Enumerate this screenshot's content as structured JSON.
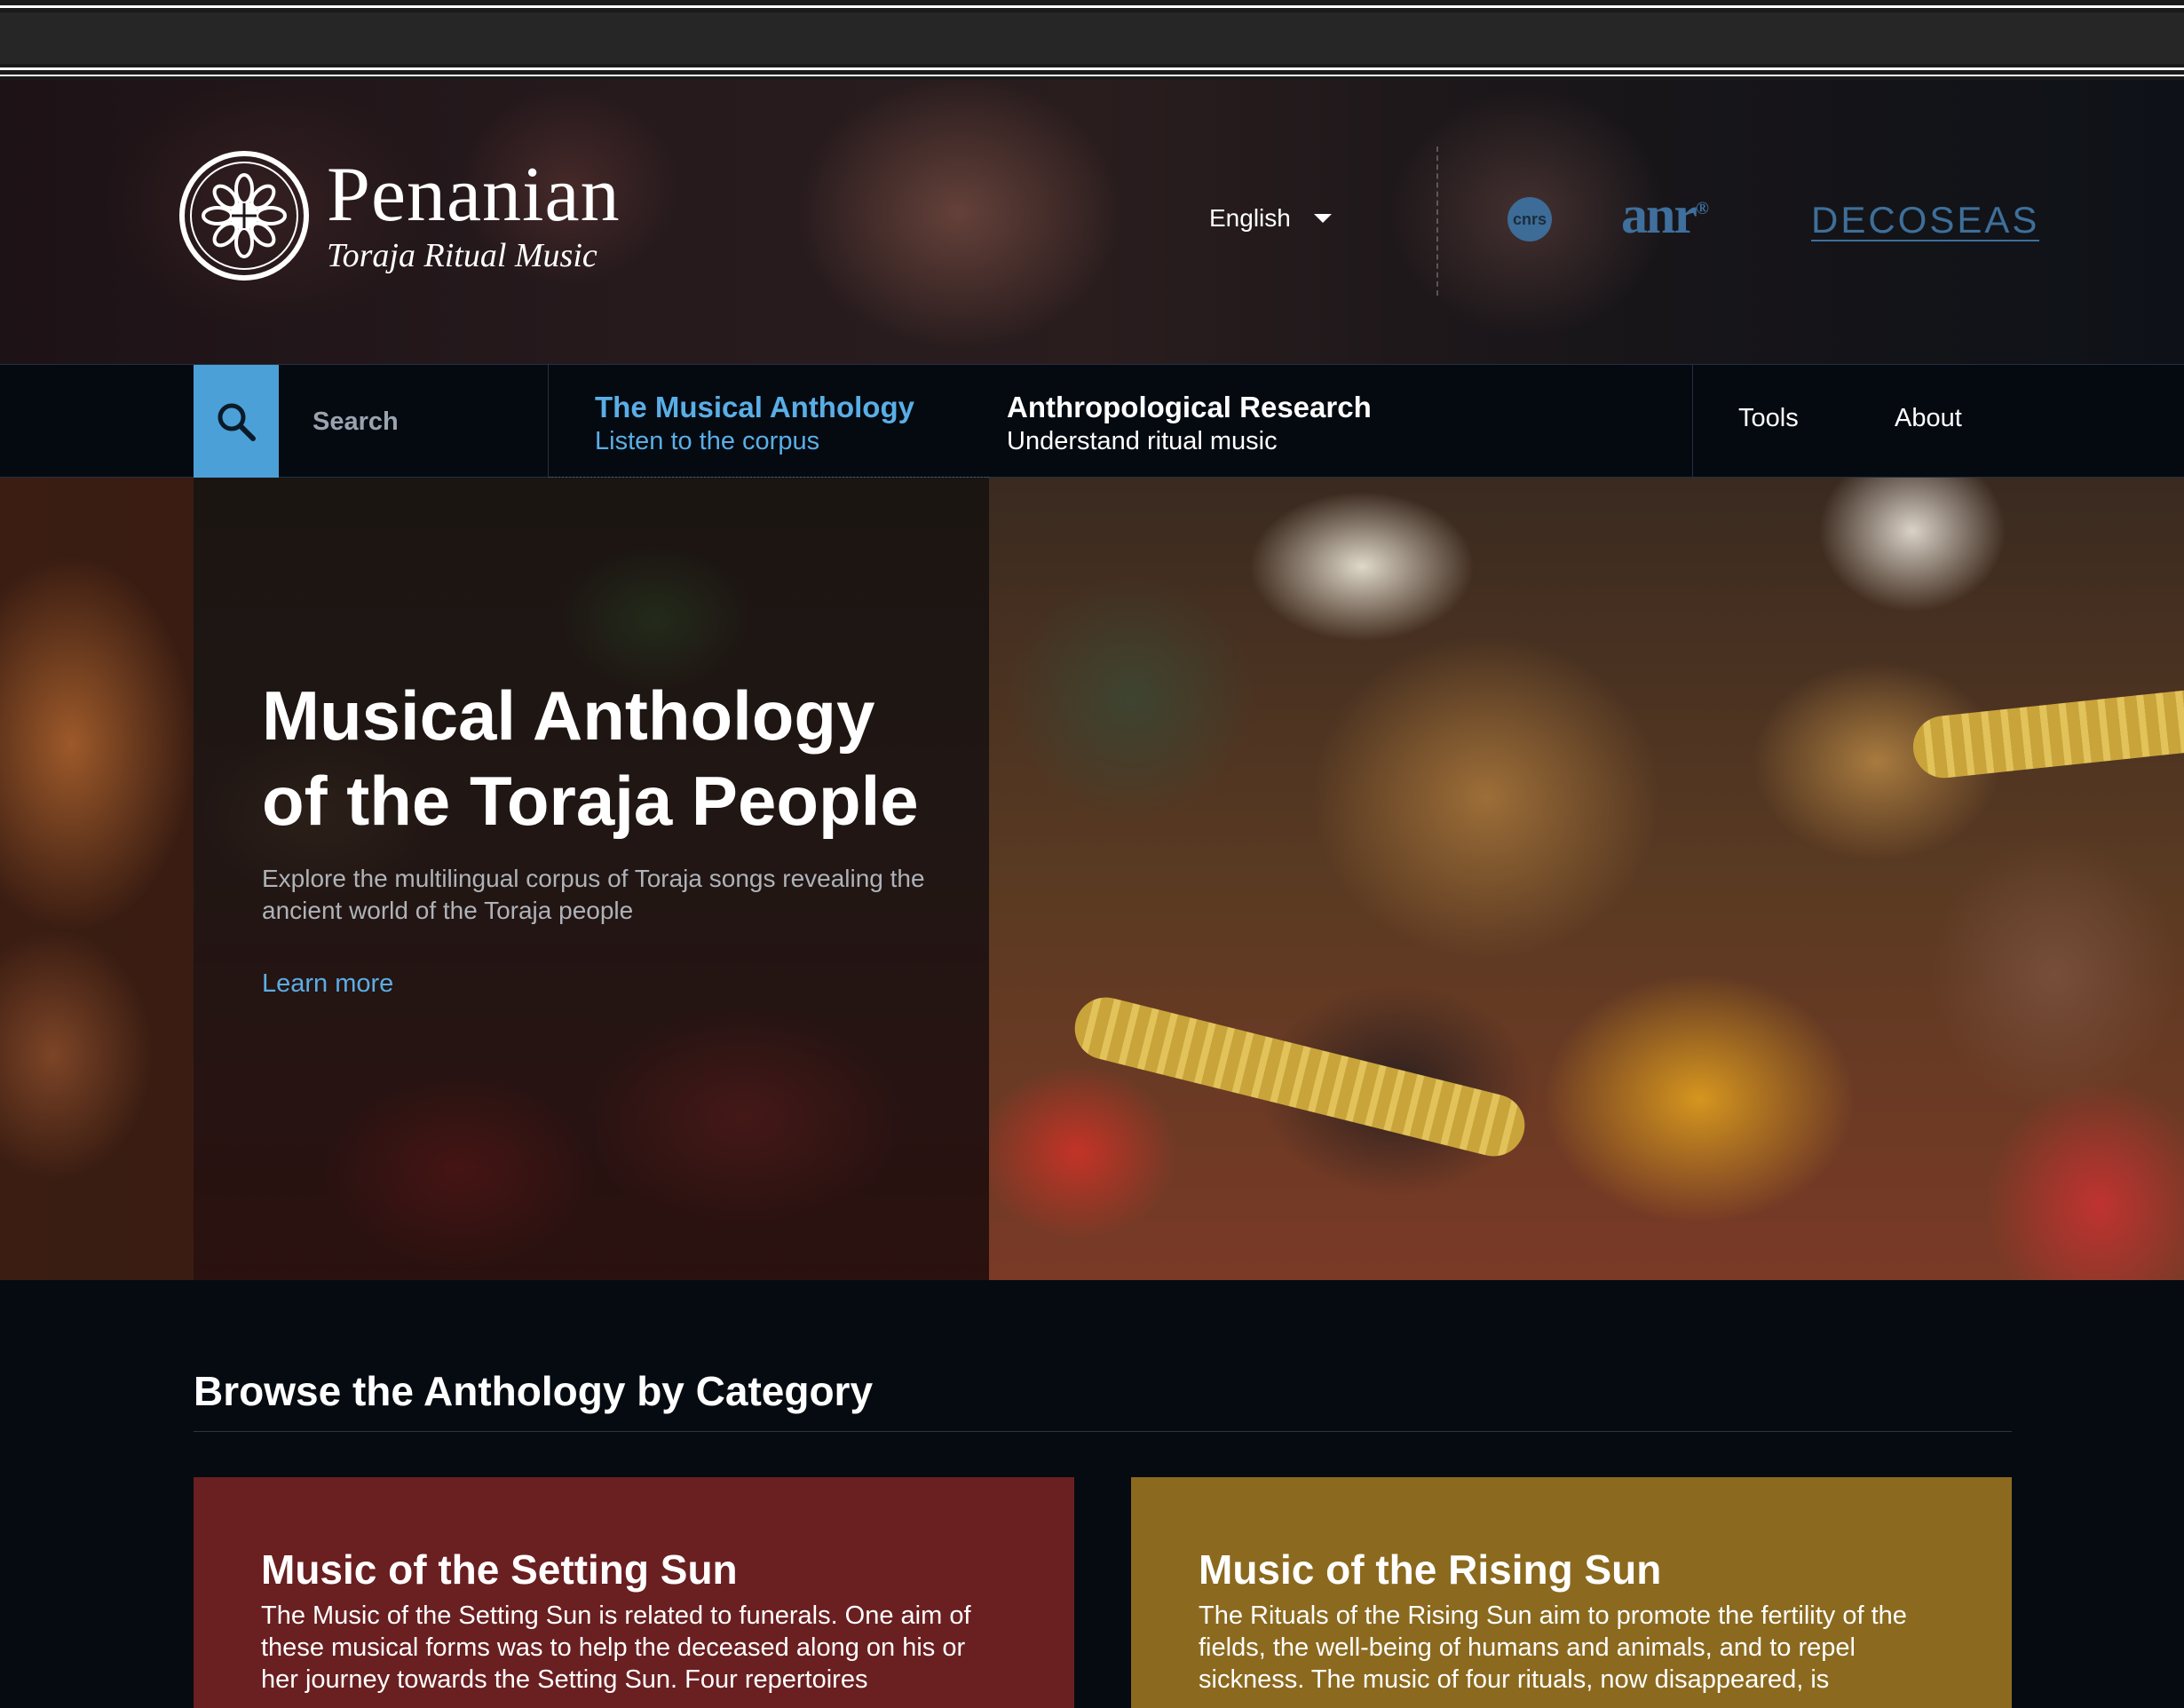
{
  "header": {
    "logo_title": "Penanian",
    "logo_subtitle": "Toraja Ritual Music",
    "language": "English",
    "partners": {
      "cnrs": "cnrs",
      "anr": "anr",
      "decoseas": "DECOSEAS"
    }
  },
  "nav": {
    "search_placeholder": "Search",
    "anthology_title": "The Musical Anthology",
    "anthology_sub": "Listen to the corpus",
    "research_title": "Anthropological Research",
    "research_sub": "Understand ritual music",
    "tools": "Tools",
    "about": "About"
  },
  "hero": {
    "title": "Musical Anthology of the Toraja People",
    "description": "Explore the multilingual corpus of Toraja songs revealing the ancient world of the Toraja people",
    "link": "Learn more"
  },
  "browse": {
    "title": "Browse the Anthology by Category",
    "cards": [
      {
        "title": "Music of the Setting Sun",
        "text": "The Music of the Setting Sun is related to funerals. One aim of these musical forms was to help the deceased along on his or her journey towards the Setting Sun. Four repertoires",
        "color": "#6a1f21"
      },
      {
        "title": "Music of the Rising Sun",
        "text": "The Rituals of the Rising Sun aim to promote the fertility of the fields, the well-being of humans and animals, and to repel sickness. The music of four rituals, now disappeared, is",
        "color": "#8b6a1f"
      }
    ]
  },
  "colors": {
    "accent": "#4ba0d8",
    "link": "#5aaee6",
    "background": "#060b12"
  }
}
